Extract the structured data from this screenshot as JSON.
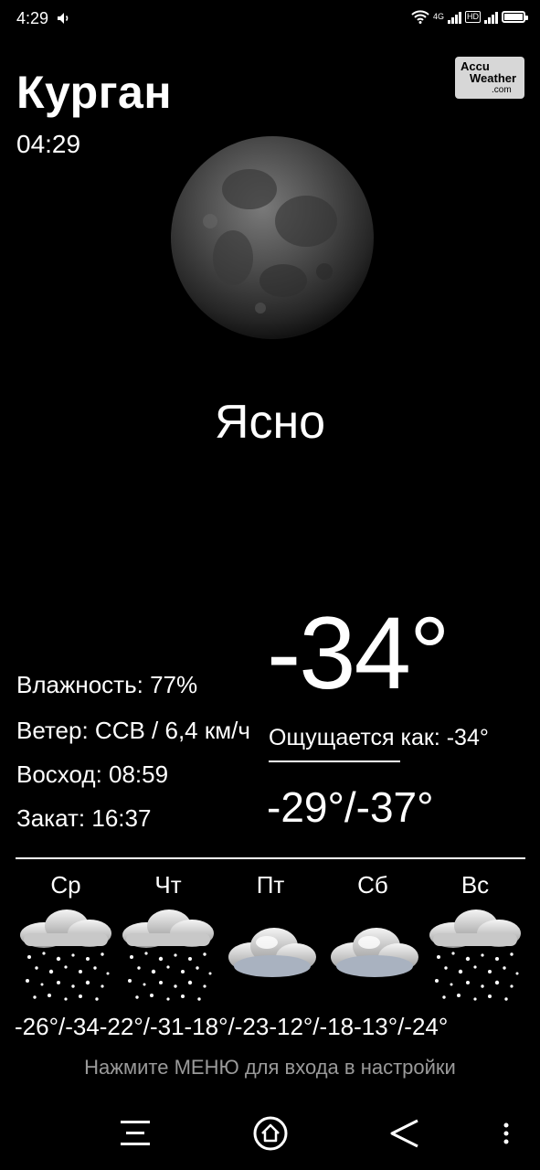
{
  "status_bar": {
    "time": "4:29",
    "network_type": "4G",
    "hd_label": "HD",
    "battery_level": 1.0
  },
  "header": {
    "city": "Курган",
    "local_time": "04:29",
    "logo": {
      "line1": "Accu",
      "line2": "Weather",
      "line3": ".com"
    }
  },
  "current": {
    "condition": "Ясно",
    "temperature": "-34°",
    "feels_like": "Ощущается как: -34°",
    "high_low": "-29°/-37°",
    "humidity": "Влажность: 77%",
    "wind": "Ветер: ССВ / 6,4 км/ч",
    "sunrise": "Восход: 08:59",
    "sunset": "Закат: 16:37"
  },
  "forecast": {
    "days": [
      {
        "day": "Ср",
        "icon": "snow-cloud-icon"
      },
      {
        "day": "Чт",
        "icon": "snow-cloud-icon"
      },
      {
        "day": "Пт",
        "icon": "cloudy-icon"
      },
      {
        "day": "Сб",
        "icon": "cloudy-icon"
      },
      {
        "day": "Вс",
        "icon": "snow-cloud-icon"
      }
    ],
    "temps_text": "-26°/-34-22°/-31-18°/-23-12°/-18-13°/-24°"
  },
  "hint": "Нажмите МЕНЮ для входа в настройки",
  "colors": {
    "background": "#000000",
    "text": "#ffffff",
    "hint": "#9a9a9a"
  }
}
